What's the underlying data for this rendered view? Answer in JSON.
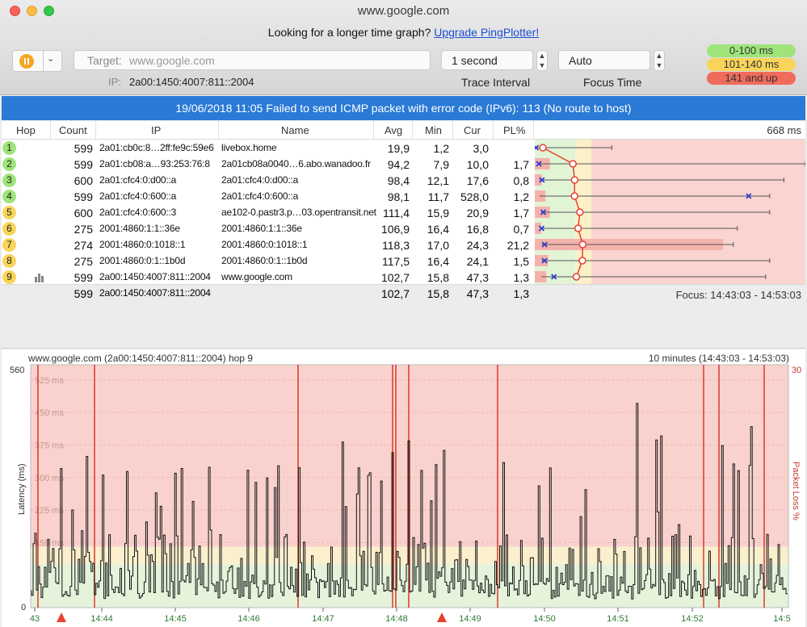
{
  "window": {
    "title": "www.google.com"
  },
  "promo": {
    "text": "Looking for a longer time graph?",
    "link": "Upgrade PingPlotter!"
  },
  "toolbar": {
    "target_label": "Target:",
    "target_value": "www.google.com",
    "ip_label": "IP:",
    "ip_value": "2a00:1450:4007:811::2004",
    "interval_value": "1 second",
    "interval_caption": "Trace Interval",
    "focus_value": "Auto",
    "focus_caption": "Focus Time"
  },
  "legend": {
    "green": "0-100 ms",
    "yellow": "101-140 ms",
    "red": "141 and up"
  },
  "colors": {
    "green": "#9fe47a",
    "yellow": "#f8d55a",
    "red": "#f06b5c",
    "banner": "#2a7ad6"
  },
  "banner": {
    "text": "19/06/2018 11:05 Failed to send ICMP packet with error code (IPv6): 113 (No route to host)"
  },
  "table": {
    "headers": {
      "hop": "Hop",
      "count": "Count",
      "ip": "IP",
      "name": "Name",
      "avg": "Avg",
      "min": "Min",
      "cur": "Cur",
      "pl": "PL%",
      "scale": "668 ms"
    },
    "rows": [
      {
        "hop": "1",
        "status": "green",
        "count": "599",
        "ip": "2a01:cb0c:8…2ff:fe9c:59e6",
        "name": "livebox.home",
        "avg": "19,9",
        "min": "1,2",
        "cur": "3,0",
        "pl": "",
        "bar_min": 1.2,
        "bar_avg": 19.9,
        "bar_cur": 3.0,
        "bar_max": 190
      },
      {
        "hop": "2",
        "status": "green",
        "count": "599",
        "ip": "2a01:cb08:a…93:253:76:8",
        "name": "2a01cb08a0040…6.abo.wanadoo.fr",
        "avg": "94,2",
        "min": "7,9",
        "cur": "10,0",
        "pl": "1,7",
        "bar_min": 7.9,
        "bar_avg": 94.2,
        "bar_cur": 10.0,
        "bar_max": 668
      },
      {
        "hop": "3",
        "status": "green",
        "count": "600",
        "ip": "2a01:cfc4:0:d00::a",
        "name": "2a01:cfc4:0:d00::a",
        "avg": "98,4",
        "min": "12,1",
        "cur": "17,6",
        "pl": "0,8",
        "bar_min": 12.1,
        "bar_avg": 98.4,
        "bar_cur": 17.6,
        "bar_max": 615
      },
      {
        "hop": "4",
        "status": "green",
        "count": "599",
        "ip": "2a01:cfc4:0:600::a",
        "name": "2a01:cfc4:0:600::a",
        "avg": "98,1",
        "min": "11,7",
        "cur": "528,0",
        "pl": "1,2",
        "bar_min": 11.7,
        "bar_avg": 98.1,
        "bar_cur": 528.0,
        "bar_max": 580
      },
      {
        "hop": "5",
        "status": "yellow",
        "count": "600",
        "ip": "2a01:cfc4:0:600::3",
        "name": "ae102-0.pastr3.p…03.opentransit.net",
        "avg": "111,4",
        "min": "15,9",
        "cur": "20,9",
        "pl": "1,7",
        "bar_min": 15.9,
        "bar_avg": 111.4,
        "bar_cur": 20.9,
        "bar_max": 580
      },
      {
        "hop": "6",
        "status": "yellow",
        "count": "275",
        "ip": "2001:4860:1:1::36e",
        "name": "2001:4860:1:1::36e",
        "avg": "106,9",
        "min": "16,4",
        "cur": "16,8",
        "pl": "0,7",
        "bar_min": 16.4,
        "bar_avg": 106.9,
        "bar_cur": 16.8,
        "bar_max": 500
      },
      {
        "hop": "7",
        "status": "yellow",
        "count": "274",
        "ip": "2001:4860:0:1018::1",
        "name": "2001:4860:0:1018::1",
        "avg": "118,3",
        "min": "17,0",
        "cur": "24,3",
        "pl": "21,2",
        "bar_min": 17.0,
        "bar_avg": 118.3,
        "bar_cur": 24.3,
        "bar_max": 490
      },
      {
        "hop": "8",
        "status": "yellow",
        "count": "275",
        "ip": "2001:4860:0:1::1b0d",
        "name": "2001:4860:0:1::1b0d",
        "avg": "117,5",
        "min": "16,4",
        "cur": "24,1",
        "pl": "1,5",
        "bar_min": 16.4,
        "bar_avg": 117.5,
        "bar_cur": 24.1,
        "bar_max": 580
      },
      {
        "hop": "9",
        "status": "yellow",
        "count": "599",
        "ip": "2a00:1450:4007:811::2004",
        "name": "www.google.com",
        "avg": "102,7",
        "min": "15,8",
        "cur": "47,3",
        "pl": "1,3",
        "bar_min": 15.8,
        "bar_avg": 102.7,
        "bar_cur": 47.3,
        "bar_max": 570
      }
    ],
    "summary": {
      "count": "599",
      "ip": "2a00:1450:4007:811::2004",
      "avg": "102,7",
      "min": "15,8",
      "cur": "47,3",
      "pl": "1,3",
      "focus": "Focus: 14:43:03 - 14:53:03"
    }
  },
  "graph": {
    "title": "www.google.com (2a00:1450:4007:811::2004) hop 9",
    "range": "10 minutes (14:43:03 - 14:53:03)",
    "y_max_label": "560",
    "y_min_label": "0",
    "pl_max_label": "30",
    "y_axis_label": "Latency (ms)",
    "pl_axis_label": "Packet Loss %",
    "gridlines": [
      "525 ms",
      "450 ms",
      "375 ms",
      "300 ms",
      "225 ms",
      "150 ms"
    ],
    "x_ticks": [
      "43",
      "14:44",
      "14:45",
      "14:46",
      "14:47",
      "14:48",
      "14:49",
      "14:50",
      "14:51",
      "14:52",
      "14:5"
    ]
  }
}
